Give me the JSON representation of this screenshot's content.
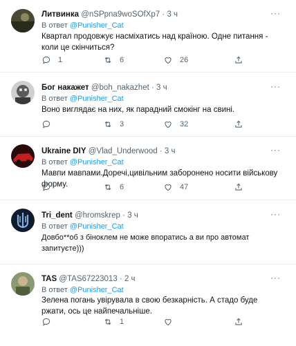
{
  "reply_prefix": "В ответ",
  "tweets": [
    {
      "name": "Литвинка",
      "handle": "@nSPpna9woSOfXp7",
      "time": "3 ч",
      "mention": "@Punisher_Cat",
      "text": "Квартал продовжує насміхатись над країною. Одне питання - коли це скінчиться?",
      "replies": "1",
      "retweets": "6",
      "likes": "26",
      "avatar_color": "#3a3a2a"
    },
    {
      "name": "Бог накажет",
      "handle": "@boh_nakazhet",
      "time": "3 ч",
      "mention": "@Punisher_Cat",
      "text": "Воно виглядає на них, як парадний смокінг на свині.",
      "replies": "",
      "retweets": "3",
      "likes": "32",
      "avatar_color": "#8a8a8a"
    },
    {
      "name": "Ukraine DIY",
      "handle": "@Vlad_Underwood",
      "time": "3 ч",
      "mention": "@Punisher_Cat",
      "text": "Мавпи мавпами.Доречі,цивільним заборонено носити військову форму.",
      "replies": "",
      "retweets": "6",
      "likes": "47",
      "avatar_color": "#b52020"
    },
    {
      "name": "Tri_dent",
      "handle": "@hromskrep",
      "time": "3 ч",
      "mention": "@Punisher_Cat",
      "text": "Довбо**об з біноклем не може впоратись а ви про автомат запитуєте)))",
      "replies": "",
      "retweets": "",
      "likes": "",
      "avatar_color": "#14243a"
    },
    {
      "name": "TAS",
      "handle": "@TAS67223013",
      "time": "2 ч",
      "mention": "@Punisher_Cat",
      "text": "Зелена погань увірувала в свою безкарність. А стадо буде ржати, ось це найпечальніше.",
      "replies": "",
      "retweets": "1",
      "likes": "",
      "avatar_color": "#6b7a55"
    }
  ],
  "icons": {
    "reply": "reply-icon",
    "retweet": "retweet-icon",
    "like": "heart-icon",
    "share": "share-icon",
    "more": "more-icon"
  },
  "colors": {
    "text": "#0f1419",
    "secondary": "#536471",
    "link": "#1d9bf0",
    "divider": "#e6ecf0"
  }
}
